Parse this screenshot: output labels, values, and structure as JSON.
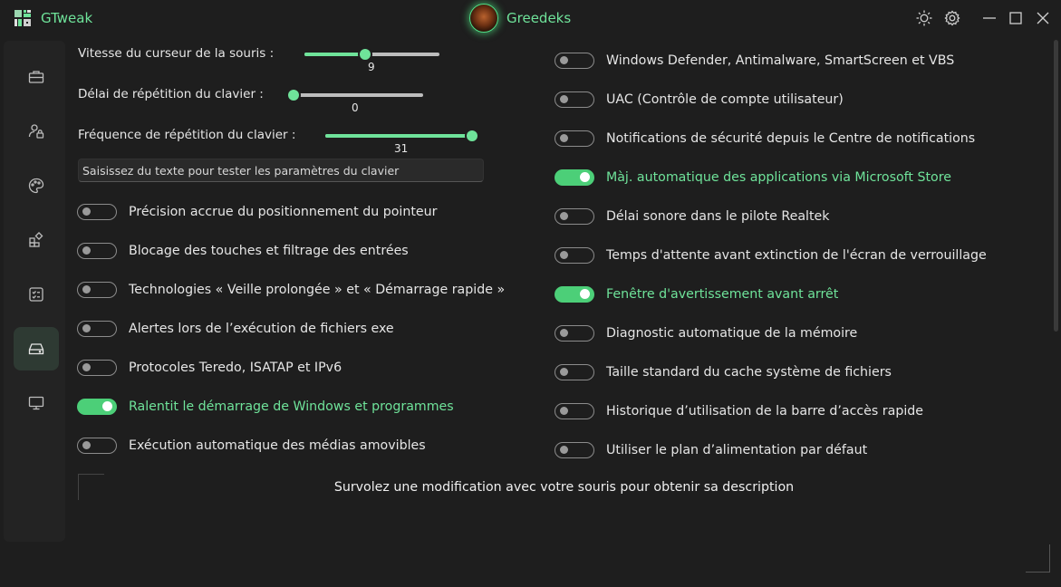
{
  "app": {
    "name": "GTweak",
    "user": "Greedeks"
  },
  "colors": {
    "accent": "#6fe39a",
    "toggle_on": "#4ccf78",
    "background": "#1e1e1e",
    "sidebar": "#232323"
  },
  "titlebar": {
    "icons": [
      "sun-icon",
      "gear-icon",
      "minimize-icon",
      "maximize-icon",
      "close-icon"
    ]
  },
  "sidebar": {
    "items": [
      {
        "icon": "briefcase-icon",
        "active": false
      },
      {
        "icon": "user-lock-icon",
        "active": false
      },
      {
        "icon": "palette-icon",
        "active": false
      },
      {
        "icon": "apps-icon",
        "active": false
      },
      {
        "icon": "checklist-icon",
        "active": false
      },
      {
        "icon": "drive-icon",
        "active": true
      },
      {
        "icon": "monitor-icon",
        "active": false
      }
    ]
  },
  "sliders": [
    {
      "label": "Vitesse du curseur de la souris :",
      "value": "9",
      "fraction": 0.45
    },
    {
      "label": "Délai de répétition du clavier :",
      "value": "0",
      "fraction": 0.0
    },
    {
      "label": "Fréquence de répétition du clavier :",
      "value": "31",
      "fraction": 1.0
    }
  ],
  "keyboard_test": {
    "placeholder": "Saisissez du texte pour tester les paramètres du clavier"
  },
  "left_toggles": [
    {
      "label": "Précision accrue du positionnement du pointeur",
      "on": false
    },
    {
      "label": "Blocage des touches et filtrage des entrées",
      "on": false
    },
    {
      "label": "Technologies « Veille prolongée » et « Démarrage rapide »",
      "on": false
    },
    {
      "label": "Alertes lors de l’exécution de fichiers exe",
      "on": false
    },
    {
      "label": "Protocoles Teredo, ISATAP et IPv6",
      "on": false
    },
    {
      "label": "Ralentit le démarrage de Windows et programmes",
      "on": true
    },
    {
      "label": "Exécution automatique des médias amovibles",
      "on": false
    }
  ],
  "right_toggles": [
    {
      "label": "Windows Defender, Antimalware, SmartScreen et VBS",
      "on": false
    },
    {
      "label": "UAC (Contrôle de compte utilisateur)",
      "on": false
    },
    {
      "label": "Notifications de sécurité depuis le Centre de notifications",
      "on": false
    },
    {
      "label": "Màj. automatique des applications via Microsoft Store",
      "on": true
    },
    {
      "label": "Délai sonore dans le pilote Realtek",
      "on": false
    },
    {
      "label": "Temps d'attente avant extinction de l'écran de verrouillage",
      "on": false
    },
    {
      "label": "Fenêtre d'avertissement avant arrêt",
      "on": true
    },
    {
      "label": "Diagnostic automatique de la mémoire",
      "on": false
    },
    {
      "label": "Taille standard du cache système de fichiers",
      "on": false
    },
    {
      "label": "Historique d’utilisation de la barre d’accès rapide",
      "on": false
    },
    {
      "label": "Utiliser le plan d’alimentation par défaut",
      "on": false
    }
  ],
  "description": "Survolez une modification avec votre souris pour obtenir sa description"
}
